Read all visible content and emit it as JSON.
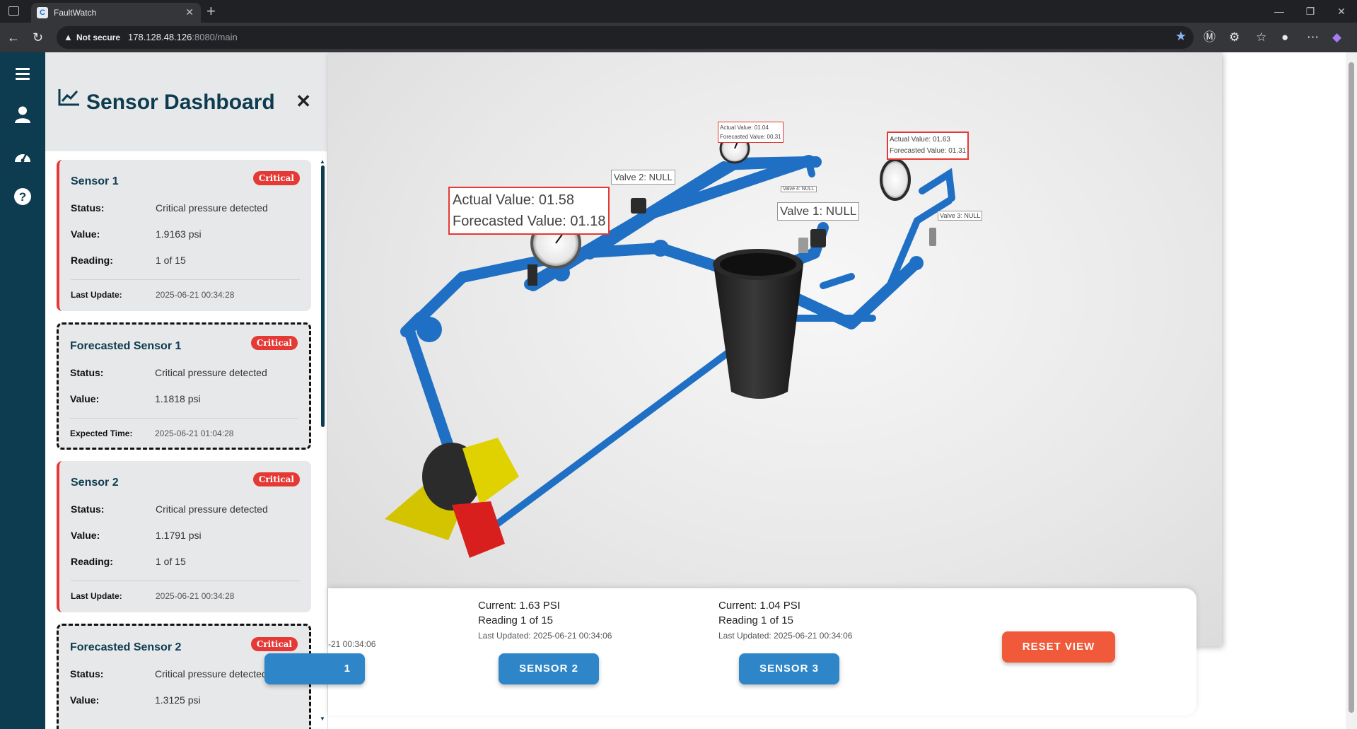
{
  "browser": {
    "tab_title": "FaultWatch",
    "security": "Not secure",
    "url_host": "178.128.48.126",
    "url_path": ":8080/main"
  },
  "rail": {
    "icons": [
      "menu-icon",
      "user-icon",
      "dashboard-icon",
      "help-icon"
    ]
  },
  "panel": {
    "title": "Sensor Dashboard",
    "cards": [
      {
        "name": "Sensor 1",
        "badge": "Critical",
        "status_label": "Status:",
        "status": "Critical pressure detected",
        "value_label": "Value:",
        "value": "1.9163 psi",
        "reading_label": "Reading:",
        "reading": "1 of 15",
        "meta_label": "Last Update:",
        "meta": "2025-06-21 00:34:28"
      },
      {
        "name": "Forecasted Sensor 1",
        "badge": "Critical",
        "status_label": "Status:",
        "status": "Critical pressure detected",
        "value_label": "Value:",
        "value": "1.1818 psi",
        "meta_label": "Expected Time:",
        "meta": "2025-06-21 01:04:28"
      },
      {
        "name": "Sensor 2",
        "badge": "Critical",
        "status_label": "Status:",
        "status": "Critical pressure detected",
        "value_label": "Value:",
        "value": "1.1791 psi",
        "reading_label": "Reading:",
        "reading": "1 of 15",
        "meta_label": "Last Update:",
        "meta": "2025-06-21 00:34:28"
      },
      {
        "name": "Forecasted Sensor 2",
        "badge": "Critical",
        "status_label": "Status:",
        "status": "Critical pressure detected",
        "value_label": "Value:",
        "value": "1.3125 psi"
      }
    ]
  },
  "scene": {
    "labels": {
      "gauge_main_actual": "Actual Value: 01.58",
      "gauge_main_forecast": "Forecasted Value: 01.18",
      "gauge_top_actual": "Actual Value: 01.04",
      "gauge_top_forecast": "Forecasted Value: 00.31",
      "gauge_right_actual": "Actual Value: 01.63",
      "gauge_right_forecast": "Forecasted Value: 01.31",
      "valve1": "Valve 1: NULL",
      "valve2": "Valve 2: NULL",
      "valve3": "Valve 3: NULL",
      "valve4": "Valve 4: NULL"
    }
  },
  "infobar": {
    "sensor1": {
      "updated_fragment": "-21 00:34:06",
      "button_fragment": "1"
    },
    "sensor2": {
      "current": "Current: 1.63 PSI",
      "reading": "Reading 1 of 15",
      "updated": "Last Updated: 2025-06-21 00:34:06",
      "button": "SENSOR 2"
    },
    "sensor3": {
      "current": "Current: 1.04 PSI",
      "reading": "Reading 1 of 15",
      "updated": "Last Updated: 2025-06-21 00:34:06",
      "button": "SENSOR 3"
    },
    "reset_button": "RESET VIEW"
  },
  "colors": {
    "accent_navy": "#0d3b4f",
    "critical_red": "#e53935",
    "pipe_blue": "#1f6fc4",
    "sensor_button_blue": "#2e86c9",
    "reset_orange": "#f05a3a"
  }
}
